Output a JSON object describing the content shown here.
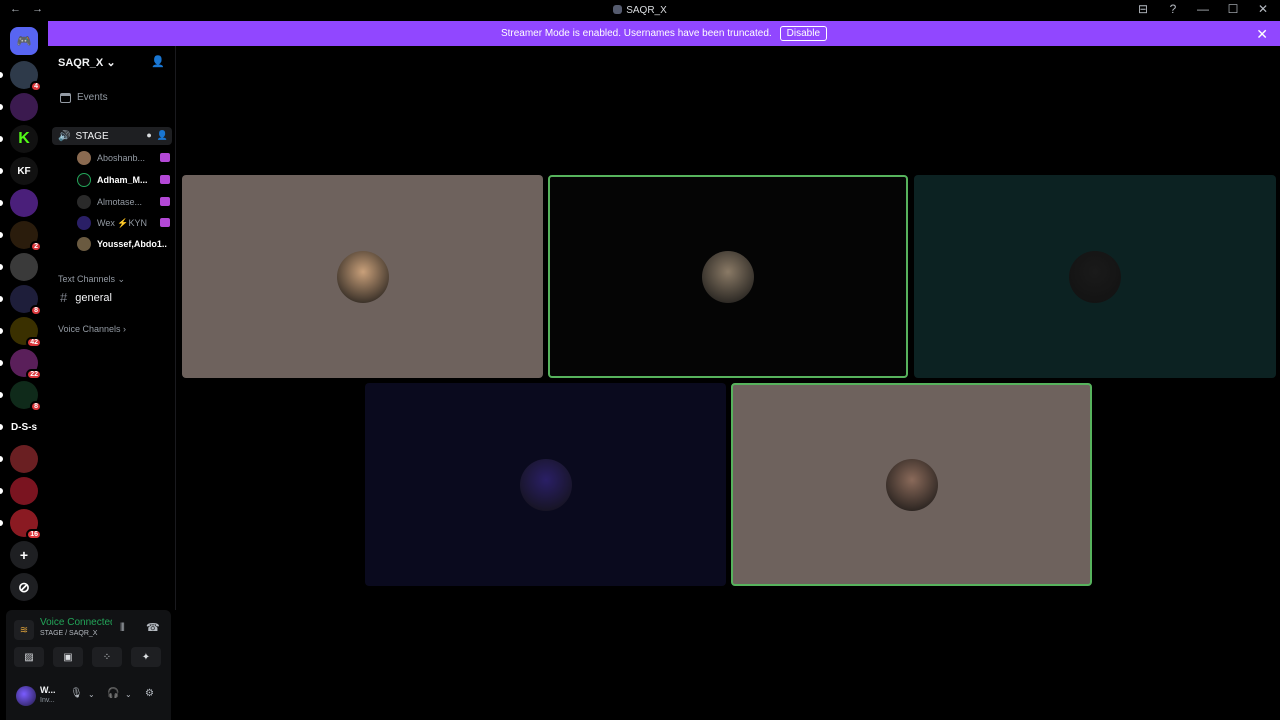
{
  "window": {
    "title": "SAQR_X",
    "nav_back": "←",
    "nav_forward": "→",
    "controls": [
      "⊟",
      "?",
      "—",
      "☐",
      "✕"
    ]
  },
  "banner": {
    "text": "Streamer Mode is enabled. Usernames have been truncated.",
    "button": "Disable",
    "close": "✕",
    "color": "#9147ff"
  },
  "guilds": [
    {
      "label": "",
      "color": "#5865f2",
      "badge": ""
    },
    {
      "label": "",
      "color": "#2e3a4a",
      "badge": "4"
    },
    {
      "label": "",
      "color": "#3b1a4f",
      "badge": ""
    },
    {
      "label": "K",
      "color": "#111111",
      "badge": ""
    },
    {
      "label": "KF",
      "color": "#111111",
      "badge": ""
    },
    {
      "label": "",
      "color": "#4a1f7a",
      "badge": ""
    },
    {
      "label": "",
      "color": "#2a1c0c",
      "badge": "2"
    },
    {
      "label": "",
      "color": "#3a3a3a",
      "badge": ""
    },
    {
      "label": "",
      "color": "#1e1e3a",
      "badge": "8"
    },
    {
      "label": "",
      "color": "#3a3000",
      "badge": "42"
    },
    {
      "label": "",
      "color": "#5a1f5a",
      "badge": "22"
    },
    {
      "label": "",
      "color": "#0f2a1a",
      "badge": "8"
    },
    {
      "label": "D-S-s",
      "color": "#000000",
      "badge": ""
    },
    {
      "label": "",
      "color": "#6a1f22",
      "badge": ""
    },
    {
      "label": "",
      "color": "#7a1420",
      "badge": ""
    },
    {
      "label": "",
      "color": "#8a1a22",
      "badge": "16"
    },
    {
      "label": "+",
      "color": "#1e1f22",
      "badge": ""
    },
    {
      "label": "⊘",
      "color": "#1e1f22",
      "badge": ""
    }
  ],
  "sidebar": {
    "server_name": "SAQR_X",
    "chevron": "⌄",
    "invite_icon": "👤",
    "events_label": "Events",
    "stage_channel": "STAGE",
    "stage_members": [
      {
        "name": "Aboshanb...",
        "color": "#8a6a50",
        "active": false
      },
      {
        "name": "Adham_M...",
        "color": "#0b0b0b",
        "active": true
      },
      {
        "name": "Almotase...",
        "color": "#2a2a2a",
        "active": false
      },
      {
        "name": "Wex ⚡ΚΥΝ",
        "color": "#2a1f66",
        "active": false
      },
      {
        "name": "Youssef,Abdo1...",
        "color": "#6a5a40",
        "active": true
      }
    ],
    "text_channels_label": "Text Channels",
    "text_channel_name": "general",
    "voice_channels_label": "Voice Channels"
  },
  "voice_panel": {
    "status": "Voice Connected",
    "location": "STAGE / SAQR_X",
    "wave_icon": "⦀",
    "hangup_icon": "☎",
    "buttons": [
      "▨",
      "▣",
      "⁘",
      "✦"
    ],
    "user_name": "W...",
    "user_status": "Inv...",
    "mic_icon": "🎙",
    "headset_icon": "🎧",
    "settings_icon": "⚙"
  },
  "stage_tiles": [
    {
      "bg": "#6e625d",
      "avatar": "#c9a07a",
      "speaking": false
    },
    {
      "bg": "#050505",
      "avatar": "#8a7a66",
      "speaking": true
    },
    {
      "bg": "#0c2222",
      "avatar": "#1a1a1a",
      "speaking": false
    },
    {
      "bg": "#0a0a1e",
      "avatar": "#2a1f66",
      "speaking": false
    },
    {
      "bg": "#6e625d",
      "avatar": "#8a6a5a",
      "speaking": true
    }
  ]
}
